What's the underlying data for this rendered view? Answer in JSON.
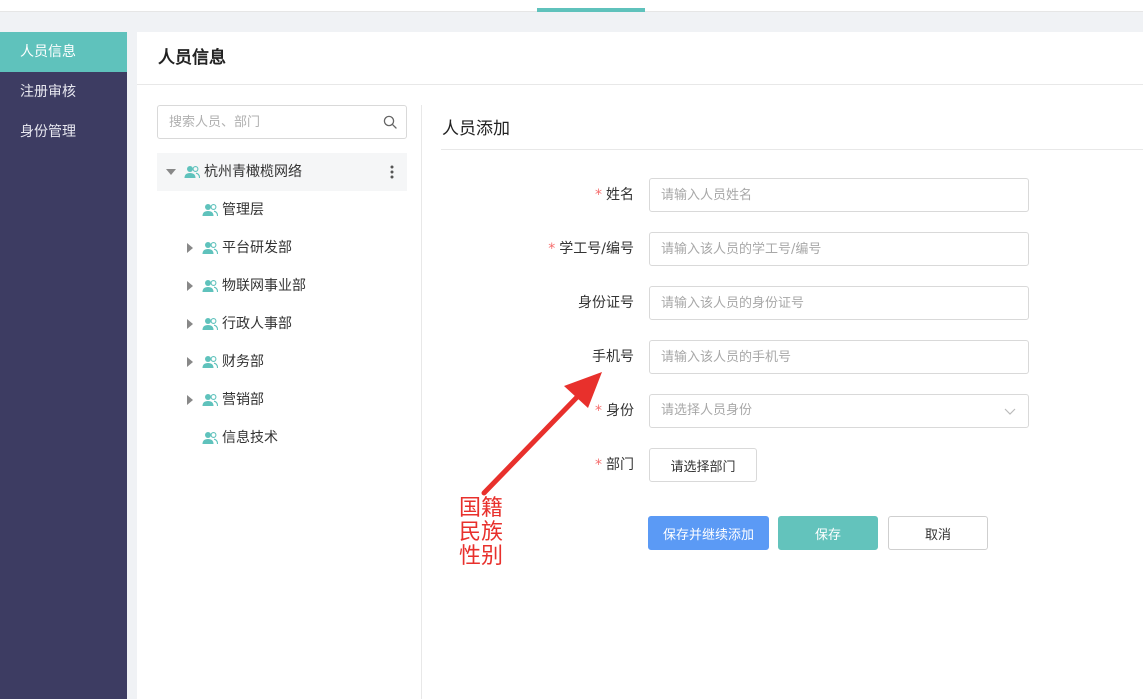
{
  "sidebar": {
    "items": [
      {
        "label": "人员信息",
        "active": true
      },
      {
        "label": "注册审核",
        "active": false
      },
      {
        "label": "身份管理",
        "active": false
      }
    ]
  },
  "header": {
    "title": "人员信息"
  },
  "search": {
    "placeholder": "搜索人员、部门",
    "icon": "search-icon"
  },
  "tree": {
    "root": {
      "label": "杭州青橄榄网络",
      "expanded": true
    },
    "children": [
      {
        "label": "管理层",
        "has_children": false
      },
      {
        "label": "平台研发部",
        "has_children": true
      },
      {
        "label": "物联网事业部",
        "has_children": true
      },
      {
        "label": "行政人事部",
        "has_children": true
      },
      {
        "label": "财务部",
        "has_children": true
      },
      {
        "label": "营销部",
        "has_children": true
      },
      {
        "label": "信息技术",
        "has_children": false
      }
    ]
  },
  "form": {
    "title": "人员添加",
    "fields": {
      "name": {
        "label": "姓名",
        "placeholder": "请输入人员姓名",
        "required": true
      },
      "student_id": {
        "label": "学工号/编号",
        "placeholder": "请输入该人员的学工号/编号",
        "required": true
      },
      "id_card": {
        "label": "身份证号",
        "placeholder": "请输入该人员的身份证号",
        "required": false
      },
      "phone": {
        "label": "手机号",
        "placeholder": "请输入该人员的手机号",
        "required": false
      },
      "identity": {
        "label": "身份",
        "placeholder": "请选择人员身份",
        "required": true
      },
      "department": {
        "label": "部门",
        "button_label": "请选择部门",
        "required": true
      }
    },
    "required_mark": "*",
    "buttons": {
      "save_continue": "保存并继续添加",
      "save": "保存",
      "cancel": "取消"
    }
  },
  "annotation": {
    "text": "国籍民族性别",
    "color": "#e8302c"
  },
  "colors": {
    "sidebar_bg": "#3d3c62",
    "accent": "#5fc2bc",
    "primary_blue": "#5b9af5",
    "required_red": "#f56c6c"
  }
}
